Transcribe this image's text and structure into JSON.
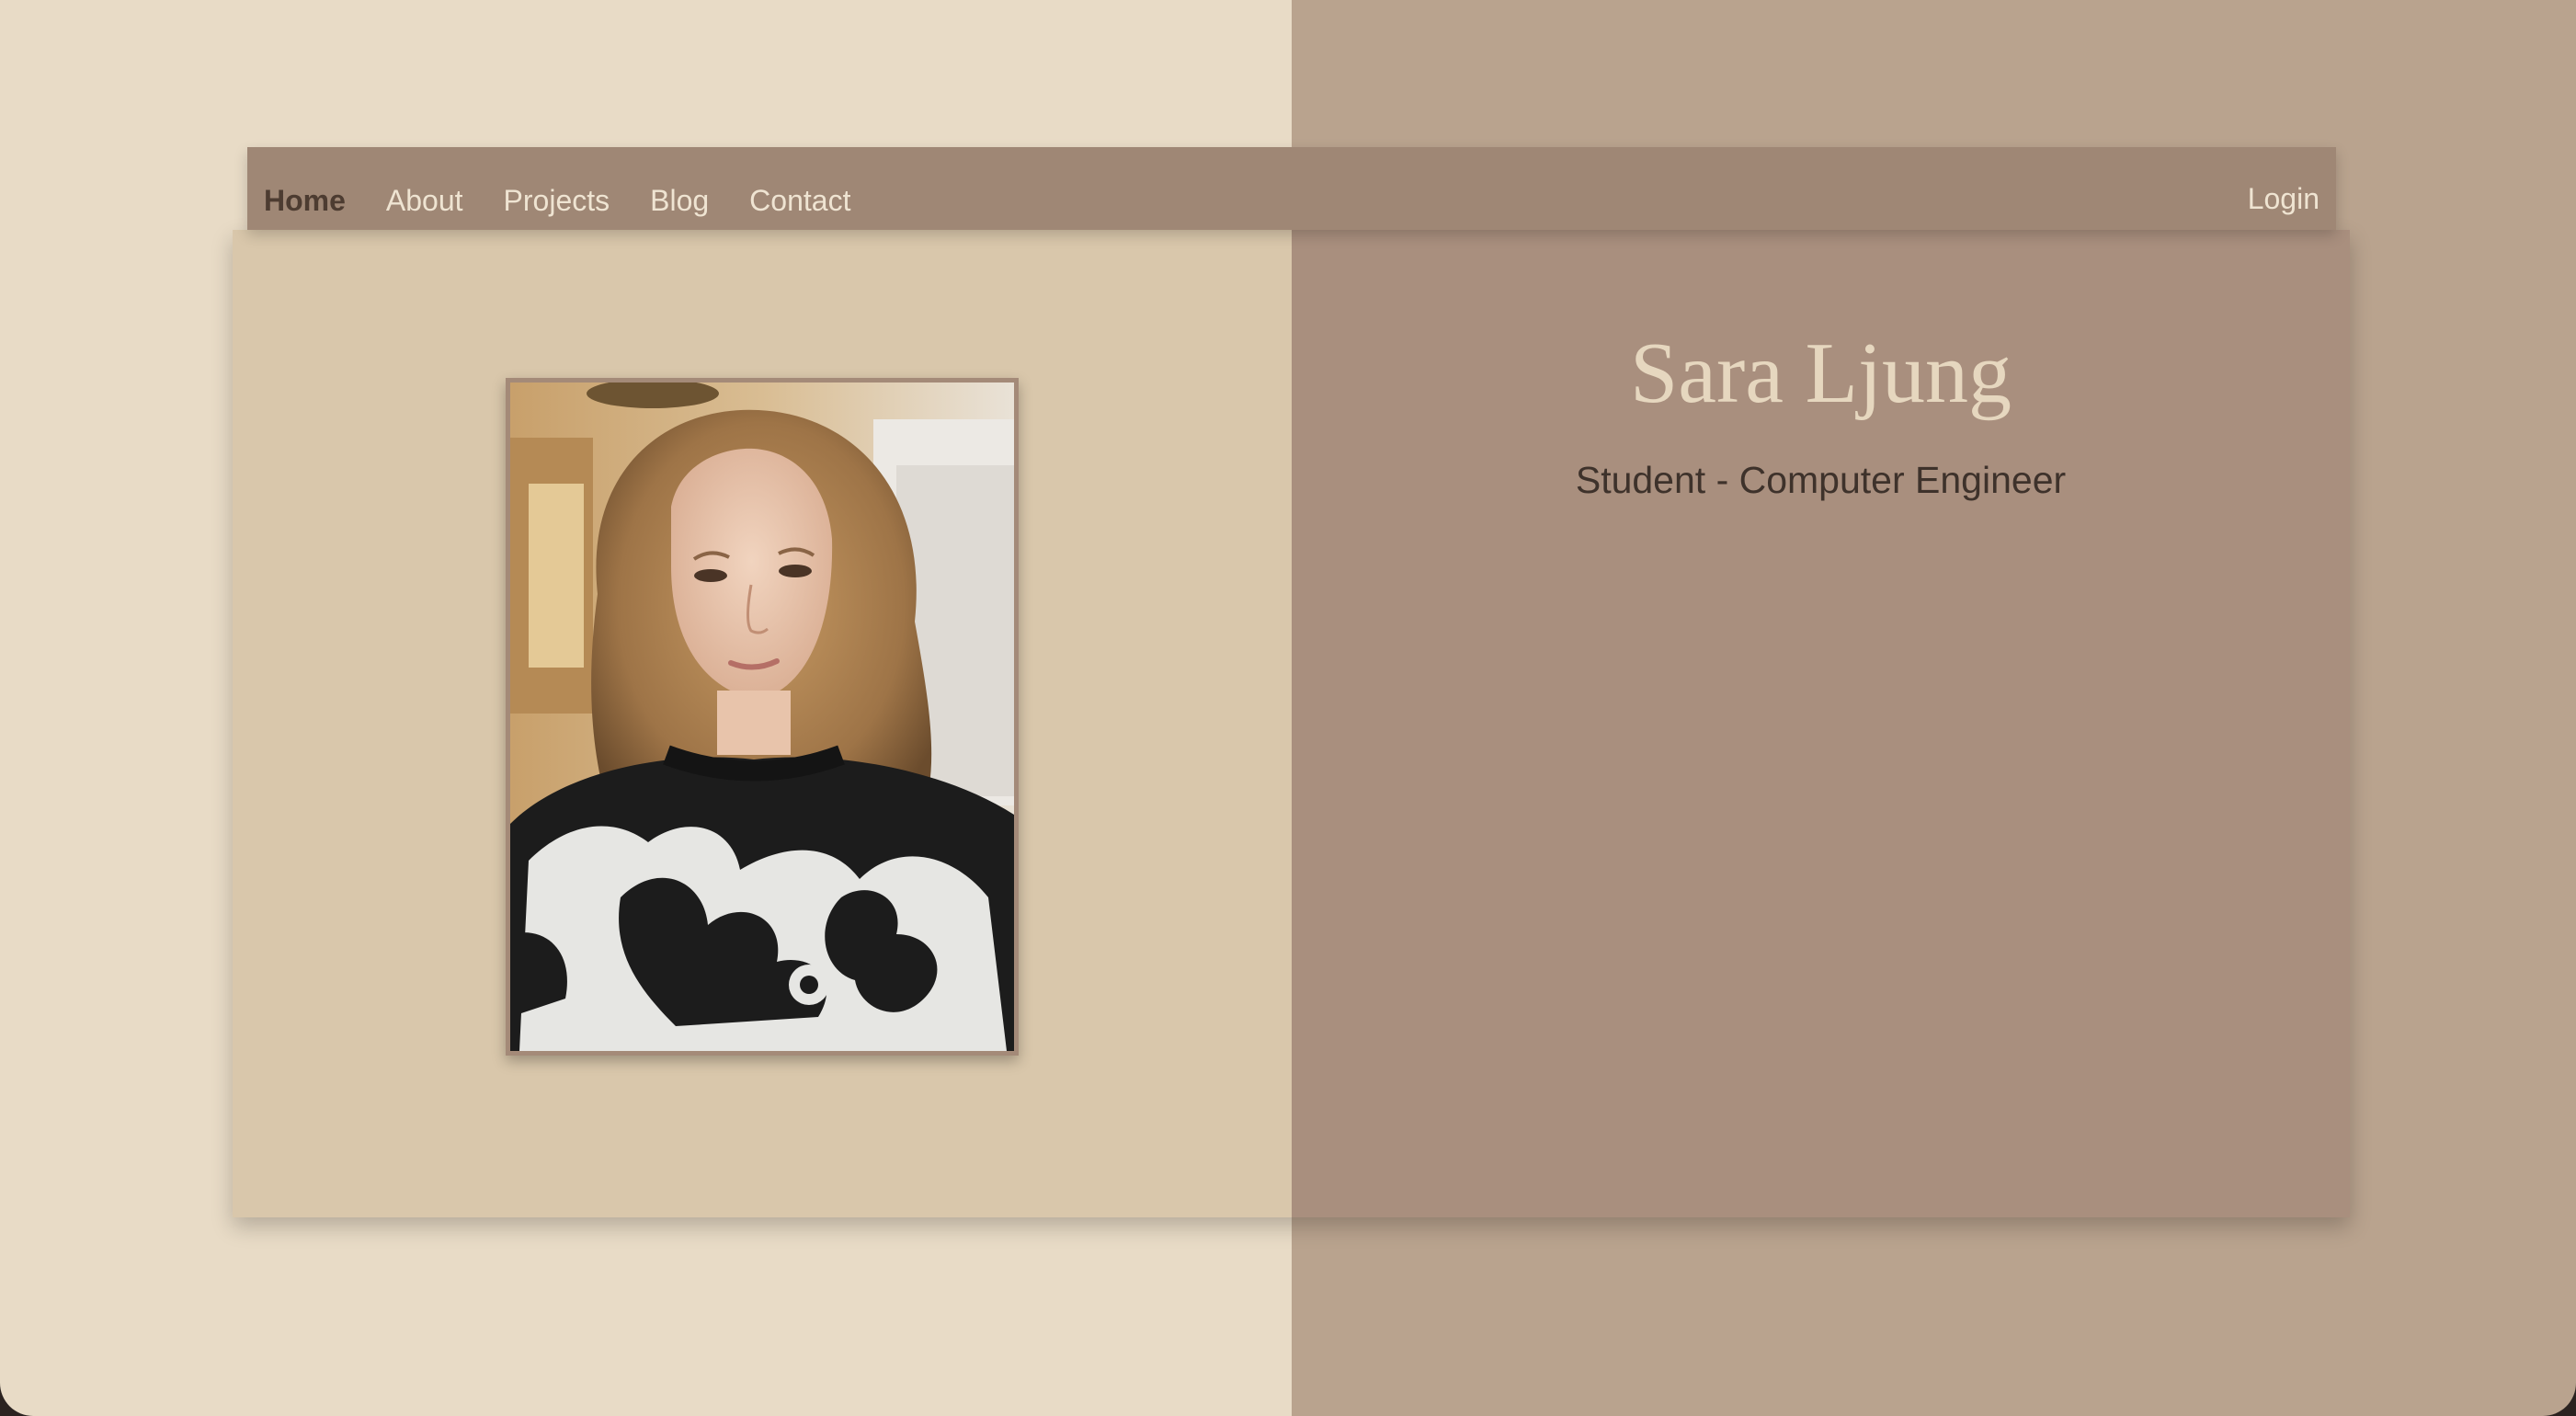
{
  "nav": {
    "items": [
      {
        "label": "Home",
        "active": true
      },
      {
        "label": "About"
      },
      {
        "label": "Projects"
      },
      {
        "label": "Blog"
      },
      {
        "label": "Contact"
      }
    ],
    "login_label": "Login"
  },
  "profile": {
    "name": "Sara Ljung",
    "title": "Student - Computer Engineer"
  },
  "colors": {
    "background_left": "#e8dbc6",
    "background_right": "#b9a38e",
    "navbar": "#9f8775",
    "card_left": "#d9c7ab",
    "card_right": "#a98f7e",
    "nav_text": "#efe4d2",
    "nav_active_text": "#4d3c31"
  }
}
